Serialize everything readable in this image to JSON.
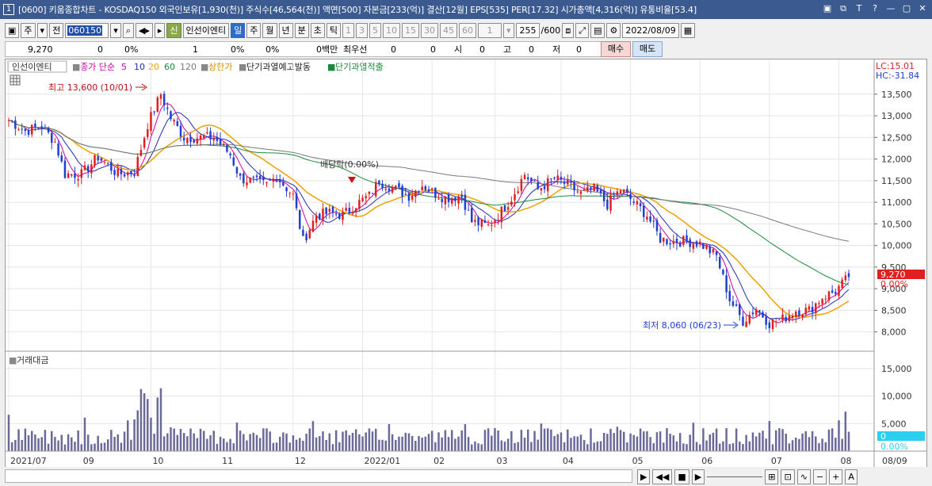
{
  "window": {
    "icon_num": "1",
    "title": "[0600] 키움종합차트 - KOSDAQ150 외국인보유[1,930(천)] 주식수[46,564(천)] 액면[500] 자본금[233(억)] 결산[12월] EPS[535] PER[17.32] 시가총액[4,316(억)] 유통비율[53.4]",
    "controls": [
      "▣",
      "⧉",
      "T",
      "?",
      "—",
      "▢",
      "✕"
    ]
  },
  "toolbar": {
    "period_select": "주",
    "all_label": "전",
    "code": "060150",
    "stock_name": "인선이엔티",
    "sin_label": "신",
    "periods": [
      "일",
      "주",
      "월",
      "년",
      "분",
      "초",
      "틱"
    ],
    "selected_period": "일",
    "minutes": [
      "1",
      "3",
      "5",
      "10",
      "15",
      "30",
      "45",
      "60"
    ],
    "unit_value": "1",
    "count": "255",
    "count_max": "/600",
    "date": "2022/08/09"
  },
  "info": {
    "price": "9,270",
    "change": "0",
    "change_pct": "0%",
    "volume": "1",
    "vol_pct": "0%",
    "vol_pct2": "0%",
    "amount": "0백만",
    "best_ask_label": "최우선",
    "best_ask": "0",
    "bid": "0",
    "open_label": "시",
    "open": "0",
    "high_label": "고",
    "high": "0",
    "low_label": "저",
    "low": "0"
  },
  "buttons": {
    "buy": "매수",
    "sell": "매도"
  },
  "legend": {
    "name": "인선이엔티",
    "ma_label": "종가 단순",
    "ma_periods": [
      "5",
      "10",
      "20",
      "60",
      "120"
    ],
    "upper": "상한가",
    "alert1": "단기과열예고발동",
    "alert2": "단기과열적출"
  },
  "right_info": {
    "lc": "LC:15.01",
    "hc": "HC:-31.84"
  },
  "annotations": {
    "high": "최고 13,600 (10/01)",
    "low": "최저 8,060 (06/23)",
    "dividend": "배당락(0.00%)"
  },
  "price_axis": [
    "13,500",
    "13,000",
    "12,500",
    "12,000",
    "11,500",
    "11,000",
    "10,500",
    "10,000",
    "9,500",
    "9,000",
    "8,500",
    "8,000"
  ],
  "current_price_tag": "9,270",
  "current_pct_tag": "0.00%",
  "volume_panel": {
    "title": "거래대금",
    "axis": [
      "15,000",
      "10,000",
      "5,000"
    ],
    "tag_value": "0",
    "tag_pct": "0.00%"
  },
  "date_axis": [
    "2021/07",
    "09",
    "10",
    "11",
    "12",
    "2022/01",
    "02",
    "03",
    "04",
    "05",
    "06",
    "07",
    "08"
  ],
  "date_end": "08/09",
  "colors": {
    "up": "#e02020",
    "down": "#1f3fd0",
    "ma5": "#d000a8",
    "ma10": "#1f2fb0",
    "ma20": "#f0a000",
    "ma60": "#1a8a3a",
    "ma120": "#7a7a7a",
    "volume": "#6a6a9a"
  },
  "chart_data": {
    "type": "candlestick",
    "price_range": [
      7700,
      13900
    ],
    "volume_range": [
      0,
      17000
    ],
    "anchors": [
      [
        0,
        12900
      ],
      [
        5,
        12650
      ],
      [
        10,
        12750
      ],
      [
        14,
        12400
      ],
      [
        17,
        11650
      ],
      [
        22,
        11650
      ],
      [
        27,
        12050
      ],
      [
        33,
        11650
      ],
      [
        38,
        11700
      ],
      [
        42,
        12800
      ],
      [
        46,
        13500
      ],
      [
        49,
        12950
      ],
      [
        53,
        12500
      ],
      [
        57,
        12500
      ],
      [
        62,
        12500
      ],
      [
        67,
        12100
      ],
      [
        70,
        11550
      ],
      [
        73,
        11500
      ],
      [
        78,
        11400
      ],
      [
        81,
        11600
      ],
      [
        86,
        11150
      ],
      [
        89,
        10100
      ],
      [
        93,
        10700
      ],
      [
        97,
        10750
      ],
      [
        101,
        10700
      ],
      [
        104,
        10900
      ],
      [
        109,
        11150
      ],
      [
        112,
        11500
      ],
      [
        117,
        11300
      ],
      [
        121,
        11150
      ],
      [
        125,
        11400
      ],
      [
        129,
        11200
      ],
      [
        132,
        11100
      ],
      [
        137,
        11150
      ],
      [
        140,
        10550
      ],
      [
        145,
        10450
      ],
      [
        148,
        10700
      ],
      [
        152,
        11100
      ],
      [
        156,
        11650
      ],
      [
        160,
        11300
      ],
      [
        165,
        11550
      ],
      [
        169,
        11400
      ],
      [
        173,
        11200
      ],
      [
        177,
        11300
      ],
      [
        181,
        10950
      ],
      [
        185,
        11300
      ],
      [
        189,
        11000
      ],
      [
        193,
        10700
      ],
      [
        197,
        10150
      ],
      [
        200,
        10100
      ],
      [
        205,
        10100
      ],
      [
        209,
        10050
      ],
      [
        214,
        9750
      ],
      [
        218,
        8750
      ],
      [
        222,
        8250
      ],
      [
        226,
        8550
      ],
      [
        230,
        8200
      ],
      [
        234,
        8300
      ],
      [
        238,
        8500
      ],
      [
        242,
        8500
      ],
      [
        246,
        8800
      ],
      [
        250,
        8950
      ],
      [
        254,
        9270
      ]
    ]
  }
}
